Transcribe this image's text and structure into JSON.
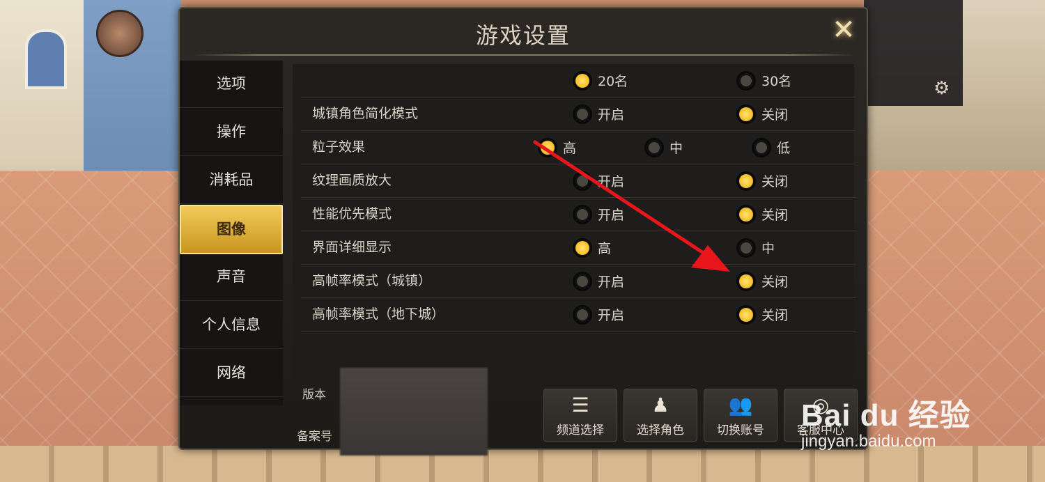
{
  "dialog": {
    "title": "游戏设置"
  },
  "sidebar": {
    "items": [
      {
        "label": "选项",
        "active": false
      },
      {
        "label": "操作",
        "active": false
      },
      {
        "label": "消耗品",
        "active": false
      },
      {
        "label": "图像",
        "active": true
      },
      {
        "label": "声音",
        "active": false
      },
      {
        "label": "个人信息",
        "active": false
      },
      {
        "label": "网络",
        "active": false
      }
    ]
  },
  "settings": {
    "rows": [
      {
        "label": "",
        "options": [
          {
            "label": "20名",
            "selected": true
          },
          {
            "label": "30名",
            "selected": false
          }
        ]
      },
      {
        "label": "城镇角色简化模式",
        "options": [
          {
            "label": "开启",
            "selected": false
          },
          {
            "label": "关闭",
            "selected": true
          }
        ]
      },
      {
        "label": "粒子效果",
        "options": [
          {
            "label": "高",
            "selected": true
          },
          {
            "label": "中",
            "selected": false
          },
          {
            "label": "低",
            "selected": false
          }
        ]
      },
      {
        "label": "纹理画质放大",
        "options": [
          {
            "label": "开启",
            "selected": false
          },
          {
            "label": "关闭",
            "selected": true
          }
        ]
      },
      {
        "label": "性能优先模式",
        "options": [
          {
            "label": "开启",
            "selected": false
          },
          {
            "label": "关闭",
            "selected": true
          }
        ]
      },
      {
        "label": "界面详细显示",
        "options": [
          {
            "label": "高",
            "selected": true
          },
          {
            "label": "中",
            "selected": false
          }
        ]
      },
      {
        "label": "高帧率模式（城镇）",
        "options": [
          {
            "label": "开启",
            "selected": false
          },
          {
            "label": "关闭",
            "selected": true
          }
        ]
      },
      {
        "label": "高帧率模式（地下城）",
        "options": [
          {
            "label": "开启",
            "selected": false
          },
          {
            "label": "关闭",
            "selected": true
          }
        ]
      }
    ]
  },
  "footer": {
    "version_label": "版本",
    "record_label": "备案号",
    "buttons": [
      {
        "label": "频道选择",
        "icon": "list-icon"
      },
      {
        "label": "选择角色",
        "icon": "character-icon"
      },
      {
        "label": "切换账号",
        "icon": "users-icon"
      },
      {
        "label": "客服中心",
        "icon": "support-icon"
      }
    ]
  },
  "watermark": {
    "logo": "Bai du 经验",
    "url": "jingyan.baidu.com"
  },
  "colors": {
    "accent": "#f2b100",
    "arrow": "#e8161b"
  }
}
